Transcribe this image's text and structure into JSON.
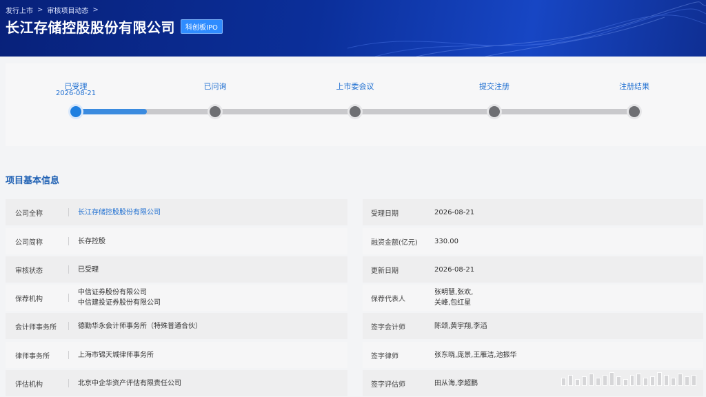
{
  "breadcrumb": {
    "items": [
      "发行上市",
      "审核项目动态"
    ],
    "separator": ">"
  },
  "header": {
    "title": "长江存储控股股份有限公司",
    "tag": "科创板IPO"
  },
  "progress": {
    "steps": [
      {
        "label": "已受理",
        "date": "2026-08-21",
        "status": "active"
      },
      {
        "label": "已问询",
        "date": "",
        "status": "pending"
      },
      {
        "label": "上市委会议",
        "date": "",
        "status": "pending"
      },
      {
        "label": "提交注册",
        "date": "",
        "status": "pending"
      },
      {
        "label": "注册结果",
        "date": "",
        "status": "pending"
      }
    ],
    "colors": {
      "active": "#1e7fe0",
      "pending": "#6e6f73"
    }
  },
  "section": {
    "title": "项目基本信息"
  },
  "info": {
    "left": [
      {
        "key": "公司全称",
        "value": "长江存储控股股份有限公司",
        "value2": ""
      },
      {
        "key": "公司简称",
        "value": "长存控股",
        "value2": ""
      },
      {
        "key": "审核状态",
        "value": "已受理",
        "value2": ""
      },
      {
        "key": "保荐机构",
        "value": "中信证券股份有限公司",
        "value2": "中信建投证券股份有限公司"
      },
      {
        "key": "会计师事务所",
        "value": "德勤华永会计师事务所（特殊普通合伙）",
        "value2": ""
      },
      {
        "key": "律师事务所",
        "value": "上海市锦天城律师事务所",
        "value2": ""
      },
      {
        "key": "评估机构",
        "value": "北京中企华资产评估有限责任公司",
        "value2": ""
      }
    ],
    "right": [
      {
        "key": "受理日期",
        "value": "2026-08-21",
        "value2": ""
      },
      {
        "key": "融资金额(亿元)",
        "value": "330.00",
        "value2": ""
      },
      {
        "key": "更新日期",
        "value": "2026-08-21",
        "value2": ""
      },
      {
        "key": "保荐代表人",
        "value": "张明慧,张欢,",
        "value2": "关峰,包红星"
      },
      {
        "key": "签字会计师",
        "value": "陈颂,黄宇翔,李滔",
        "value2": ""
      },
      {
        "key": "签字律师",
        "value": "张东晓,庞景,王雁洁,池振华",
        "value2": ""
      },
      {
        "key": "签字评估师",
        "value": "田从海,李超鹏",
        "value2": ""
      }
    ]
  }
}
